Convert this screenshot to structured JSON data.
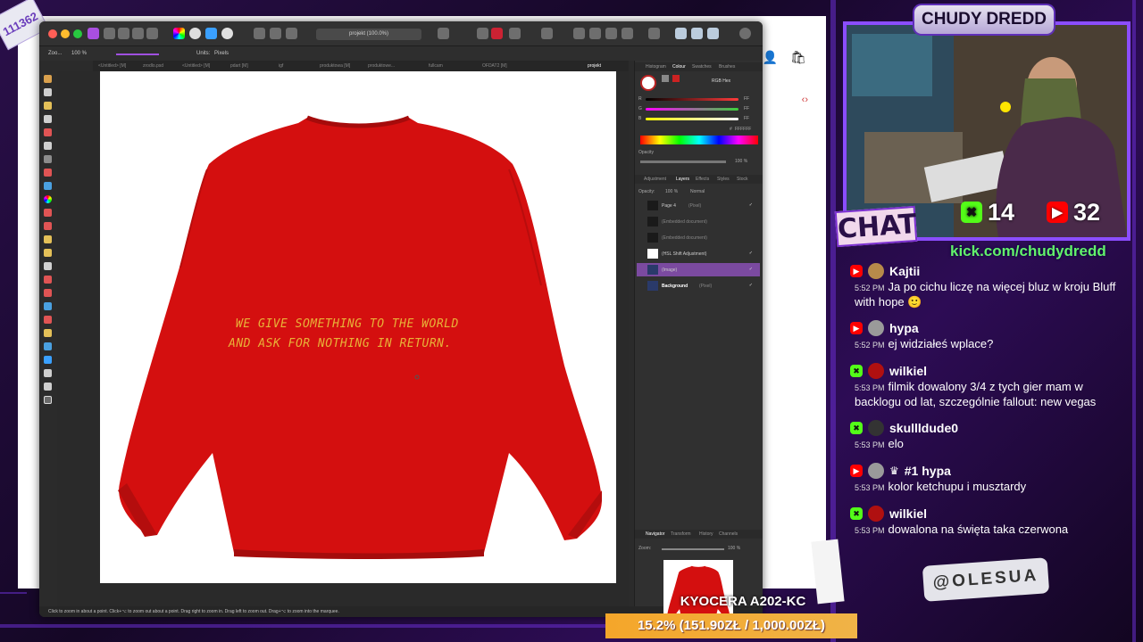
{
  "overlay_stamp": "111362",
  "app": {
    "title_bar": {
      "document": "projekt (100.0%)"
    },
    "context_bar": {
      "zoom_label": "Zoo...",
      "zoom_value": "100 %",
      "units_label": "Units:",
      "units_value": "Pixels"
    },
    "tabs": [
      "<Untitled> [M]",
      "zrodlo.psd",
      "<Untitled> [M]",
      "pdart [M]",
      "igf",
      "produktowa [M]",
      "produktowe...",
      "fullcam",
      "OFDAT2 [M]",
      "projekt"
    ],
    "canvas": {
      "print_line_1": "WE GIVE SOMETHING TO THE WORLD",
      "print_line_2": "AND ASK FOR NOTHING IN RETURN."
    },
    "status_text": "Click to zoom in about a point. Click+⌥ to zoom out about a point. Drag right to zoom in. Drag left to zoom out. Drag+⌥ to zoom into the marquee.",
    "panel": {
      "color_tabs": [
        "Histogram",
        "Colour",
        "Swatches",
        "Brushes"
      ],
      "color_mode": "RGB Hex",
      "channels": [
        {
          "label": "R",
          "value": "FF",
          "color": "#ff3b3b"
        },
        {
          "label": "G",
          "value": "FF",
          "color": "#3bd23b"
        },
        {
          "label": "B",
          "value": "FF",
          "color": "#3b6bff"
        }
      ],
      "hex_label": "#",
      "hex_value": "FFFFFF",
      "opacity_label": "Opacity",
      "opacity_value": "100 %",
      "layer_tabs": [
        "Adjustment",
        "Layers",
        "Effects",
        "Styles",
        "Stock"
      ],
      "layer_opacity_label": "Opacity:",
      "layer_opacity_value": "100 %",
      "blend_mode": "Normal",
      "layers": [
        {
          "name": "Page 4",
          "type": "(Pixel)",
          "check": "✓"
        },
        {
          "name": "(Embedded document)",
          "type": "",
          "check": ""
        },
        {
          "name": "(Embedded document)",
          "type": "",
          "check": ""
        },
        {
          "name": "(HSL Shift Adjustment)",
          "type": "",
          "check": "✓"
        },
        {
          "name": "(Image)",
          "type": "",
          "check": "✓"
        },
        {
          "name": "Background",
          "type": "(Pixel)",
          "check": "✓"
        }
      ],
      "nav_tabs": [
        "Navigator",
        "Transform",
        "History",
        "Channels"
      ],
      "nav_zoom_label": "Zoom:",
      "nav_zoom_value": "100 %"
    }
  },
  "stream": {
    "channel_name": "CHUDY DREDD",
    "chat_badge": "CHAT",
    "kick_viewers": "14",
    "youtube_viewers": "32",
    "kick_url": "kick.com/chudydredd",
    "messages": [
      {
        "platform": "youtube",
        "user": "Kajtii",
        "time": "5:52 PM",
        "text": "Ja po cichu liczę na więcej bluz w kroju Bluff with hope 🙂"
      },
      {
        "platform": "youtube",
        "user": "hypa",
        "time": "5:52 PM",
        "text": "ej widziałeś wplace?"
      },
      {
        "platform": "kick",
        "user": "wilkiel",
        "time": "5:53 PM",
        "text": "filmik dowalony 3/4 z tych gier mam w backlogu od lat, szczególnie fallout: new vegas"
      },
      {
        "platform": "kick",
        "user": "skullldude0",
        "time": "5:53 PM",
        "text": "elo"
      },
      {
        "platform": "youtube",
        "user": "#1 hypa",
        "time": "5:53 PM",
        "text": "kolor ketchupu i musztardy"
      },
      {
        "platform": "kick",
        "user": "wilkiel",
        "time": "5:53 PM",
        "text": "dowalona na święta taka czerwona"
      }
    ],
    "handle": "@OLESUA",
    "printer": "KYOCERA A202-KC",
    "goal": "15.2% (151.90ZŁ / 1,000.00ZŁ)",
    "colors": {
      "kick": "#53fc18",
      "youtube": "#ff0000",
      "accent": "#8b4dff",
      "sweater": "#d40f0f",
      "print": "#e8b238"
    }
  }
}
